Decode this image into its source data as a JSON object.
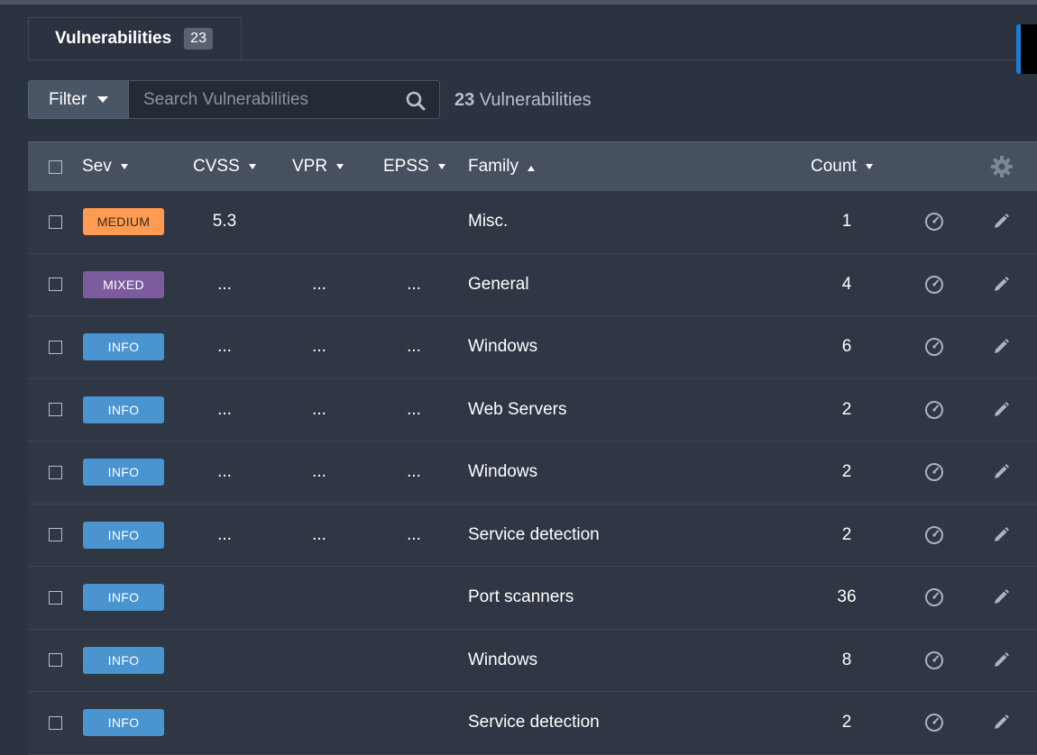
{
  "tab": {
    "label": "Vulnerabilities",
    "count": "23"
  },
  "toolbar": {
    "filter_label": "Filter",
    "search_placeholder": "Search Vulnerabilities",
    "total_count": "23",
    "total_suffix": " Vulnerabilities"
  },
  "columns": {
    "sev": "Sev",
    "cvss": "CVSS",
    "vpr": "VPR",
    "epss": "EPSS",
    "family": "Family",
    "count": "Count"
  },
  "colors": {
    "MEDIUM": "#fd9b53",
    "MIXED": "#7c5c9e",
    "INFO": "#4a94d0",
    "MEDIUM_text": "#3a2a18",
    "MIXED_text": "#ffffff",
    "INFO_text": "#ffffff"
  },
  "rows": [
    {
      "severity": "MEDIUM",
      "cvss": "5.3",
      "vpr": "",
      "epss": "",
      "family": "Misc.",
      "count": "1"
    },
    {
      "severity": "MIXED",
      "cvss": "...",
      "vpr": "...",
      "epss": "...",
      "family": "General",
      "count": "4"
    },
    {
      "severity": "INFO",
      "cvss": "...",
      "vpr": "...",
      "epss": "...",
      "family": "Windows",
      "count": "6"
    },
    {
      "severity": "INFO",
      "cvss": "...",
      "vpr": "...",
      "epss": "...",
      "family": "Web Servers",
      "count": "2"
    },
    {
      "severity": "INFO",
      "cvss": "...",
      "vpr": "...",
      "epss": "...",
      "family": "Windows",
      "count": "2"
    },
    {
      "severity": "INFO",
      "cvss": "...",
      "vpr": "...",
      "epss": "...",
      "family": "Service detection",
      "count": "2"
    },
    {
      "severity": "INFO",
      "cvss": "",
      "vpr": "",
      "epss": "",
      "family": "Port scanners",
      "count": "36"
    },
    {
      "severity": "INFO",
      "cvss": "",
      "vpr": "",
      "epss": "",
      "family": "Windows",
      "count": "8"
    },
    {
      "severity": "INFO",
      "cvss": "",
      "vpr": "",
      "epss": "",
      "family": "Service detection",
      "count": "2"
    }
  ]
}
